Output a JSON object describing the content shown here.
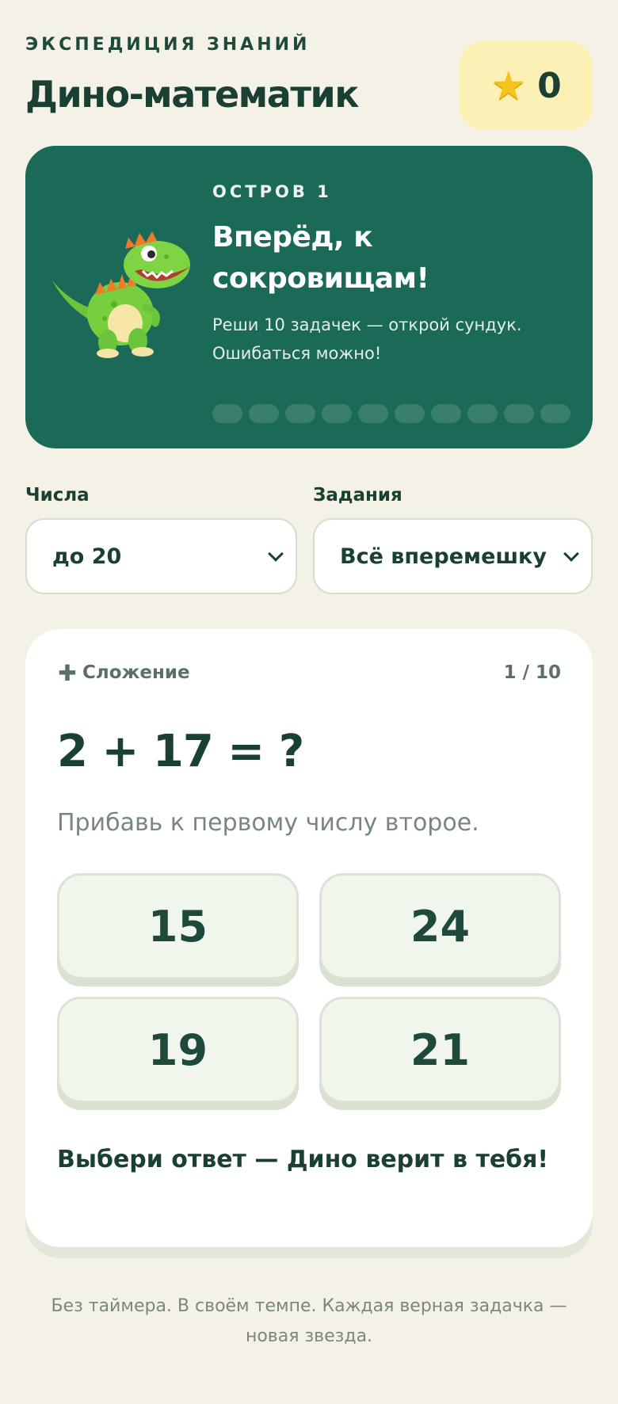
{
  "header": {
    "eyebrow": "ЭКСПЕДИЦИЯ ЗНАНИЙ",
    "title": "Дино-математик",
    "score_icon": "star-icon",
    "score": "0"
  },
  "hero": {
    "eyebrow": "ОСТРОВ 1",
    "title": "Вперёд, к сокровищам!",
    "subtitle": "Реши 10 задачек — открой сундук. Ошибаться можно!",
    "mascot": "dinosaur-mascot",
    "progress_total": 10,
    "progress_done": 0
  },
  "selectors": {
    "numbers": {
      "label": "Числа",
      "value": "до 20"
    },
    "tasks": {
      "label": "Задания",
      "value": "Всё вперемешку"
    }
  },
  "quiz": {
    "operation_icon": "plus-icon",
    "operation": "Сложение",
    "counter": "1 / 10",
    "question": "2 + 17 = ?",
    "hint": "Прибавь к первому числу второе.",
    "answers": [
      "15",
      "24",
      "19",
      "21"
    ],
    "encouragement": "Выбери ответ — Дино верит в тебя!"
  },
  "footer": {
    "note": "Без таймера. В своём темпе. Каждая верная задачка — новая звезда."
  },
  "colors": {
    "background": "#f4f2e6",
    "hero": "#1b6a58",
    "text_dark": "#1a3f33",
    "score_badge": "#fdf0b4",
    "answer_bg": "#f1f6ec"
  }
}
